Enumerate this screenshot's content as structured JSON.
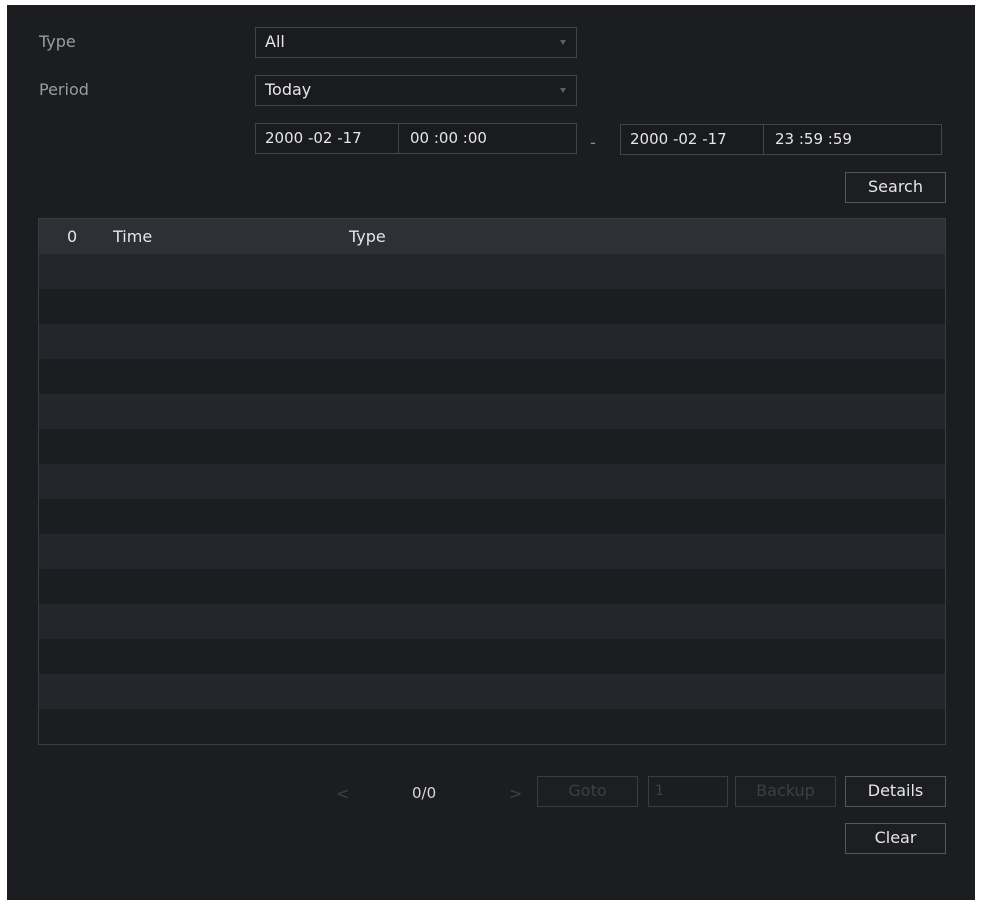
{
  "filters": {
    "type_label": "Type",
    "type_value": "All",
    "period_label": "Period",
    "period_value": "Today",
    "start_date": "2000 -02 -17",
    "start_time": "00 :00 :00",
    "range_separator": "-",
    "end_date": "2000 -02 -17",
    "end_time": "23 :59 :59",
    "search_label": "Search"
  },
  "table": {
    "count": "0",
    "columns": [
      "Time",
      "Type"
    ],
    "rows": []
  },
  "pager": {
    "prev": "<",
    "page_status": "0/0",
    "next": ">",
    "goto_label": "Goto",
    "goto_value": "1",
    "backup_label": "Backup",
    "details_label": "Details",
    "clear_label": "Clear"
  }
}
